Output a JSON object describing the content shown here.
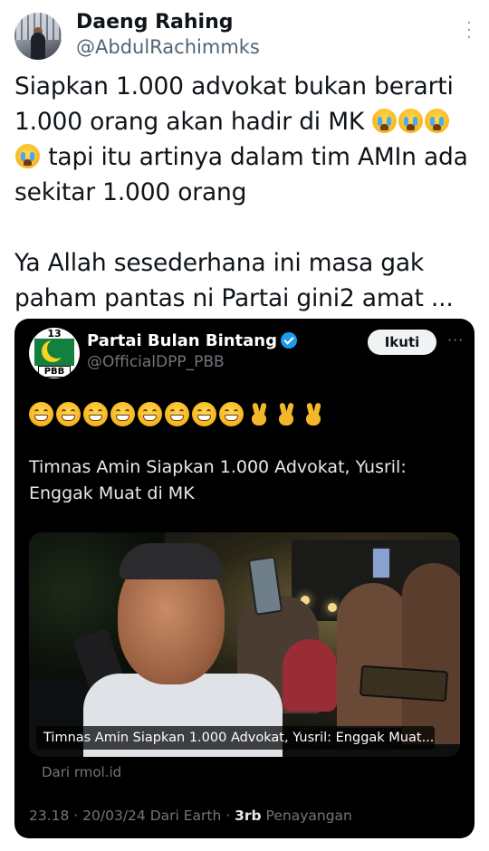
{
  "author": {
    "name": "Daeng Rahing",
    "handle": "@AbdulRachimmks",
    "more_icon": "more-vertical-icon"
  },
  "tweet": {
    "line1": "Siapkan 1.000 advokat bukan berarti",
    "line2": "1.000 orang akan hadir di MK ",
    "line3": " tapi itu artinya dalam tim AMIn ada",
    "line4": "sekitar 1.000 orang",
    "line5": "Ya Allah sesederhana ini masa gak",
    "line6": "paham pantas ni Partai gini2 amat ...",
    "emoji": "loudly-crying-face"
  },
  "quote": {
    "name": "Partai Bulan Bintang",
    "handle": "@OfficialDPP_PBB",
    "avatar_number": "13",
    "avatar_label": "PBB",
    "follow_label": "Ikuti",
    "emoji_row": [
      "grin",
      "grin",
      "grin",
      "grin",
      "grin",
      "grin",
      "grin",
      "grin",
      "victory-hand",
      "victory-hand",
      "victory-hand"
    ],
    "headline_line1": "Timnas Amin Siapkan 1.000 Advokat, Yusril:",
    "headline_line2": "Enggak Muat di MK",
    "media_caption": "Timnas Amin Siapkan 1.000 Advokat, Yusril: Enggak Muat...",
    "source": "Dari rmol.id",
    "meta_prefix": "23.18 · 20/03/24 Dari Earth · ",
    "views_count": "3rb",
    "views_label": " Penayangan"
  },
  "colors": {
    "accent_verified": "#1d9bf0",
    "card_bg": "#000000",
    "muted": "#71767b"
  }
}
